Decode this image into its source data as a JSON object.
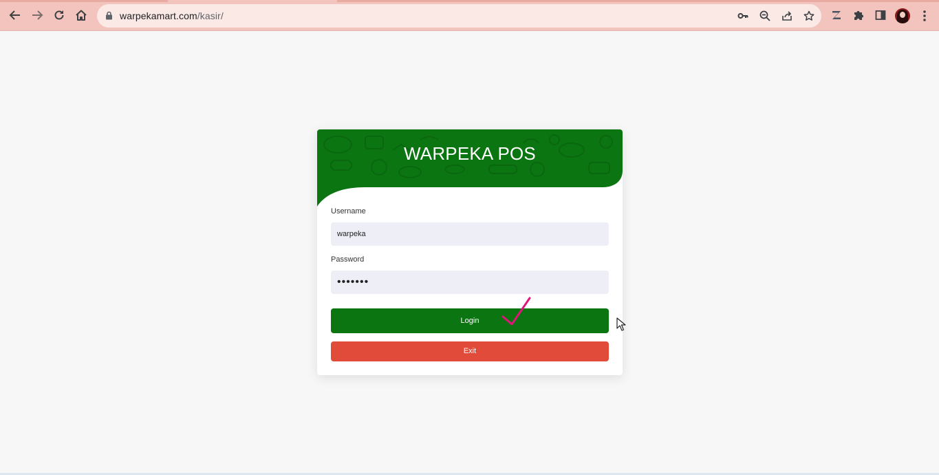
{
  "browser": {
    "url_host": "warpekamart.com",
    "url_path": "/kasir/"
  },
  "login": {
    "title": "WARPEKA POS",
    "username_label": "Username",
    "username_value": "warpeka",
    "password_label": "Password",
    "password_value": "•••••••",
    "login_label": "Login",
    "exit_label": "Exit"
  },
  "colors": {
    "header_green": "#0b7512",
    "login_button": "#0b7512",
    "exit_button": "#e04b3a",
    "chrome_pink": "#f2c4bd",
    "checkmark": "#e0157a"
  }
}
